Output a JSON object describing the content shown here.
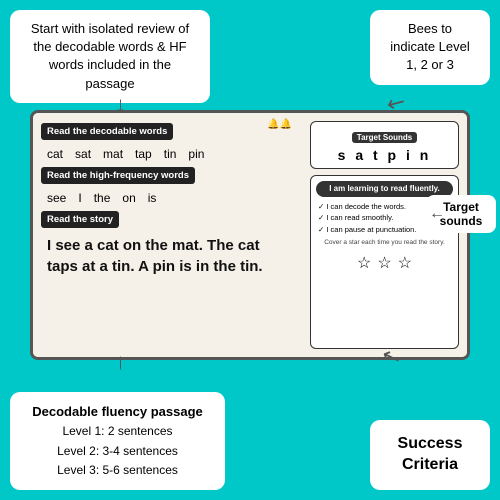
{
  "callout_top_left": {
    "text": "Start with isolated review of the decodable words & HF words included in the passage"
  },
  "callout_top_right": {
    "text": "Bees to indicate Level 1, 2 or 3"
  },
  "callout_target_sounds": {
    "label": "Target sounds"
  },
  "callout_bottom_left": {
    "title": "Decodable fluency passage",
    "line1": "Level 1: 2 sentences",
    "line2": "Level 2: 3-4 sentences",
    "line3": "Level 3: 5-6 sentences"
  },
  "callout_bottom_right": {
    "text": "Success Criteria"
  },
  "slide": {
    "section1_header": "Read the decodable words",
    "decodable_words": [
      "cat",
      "sat",
      "mat",
      "tap",
      "tin",
      "pin"
    ],
    "section2_header": "Read the high-frequency words",
    "hf_words": [
      "see",
      "I",
      "the",
      "on",
      "is"
    ],
    "section3_header": "Read the story",
    "story_text": "I see a cat on the mat. The cat taps at a tin. A pin is in the tin.",
    "target_sounds_label": "Target Sounds",
    "target_sounds": "s a t p i n",
    "learning_title": "I am learning to read fluently.",
    "learning_items": [
      "I can decode the words.",
      "I can read smoothly.",
      "I can pause at punctuation."
    ],
    "cover_text": "Cover a star each time you read the story.",
    "stars": [
      "☆",
      "☆",
      "☆"
    ]
  },
  "arrows": {
    "down": "↓",
    "up": "↑",
    "left": "←",
    "right": "→",
    "curved_down_left": "↙",
    "curved_up": "↑"
  }
}
